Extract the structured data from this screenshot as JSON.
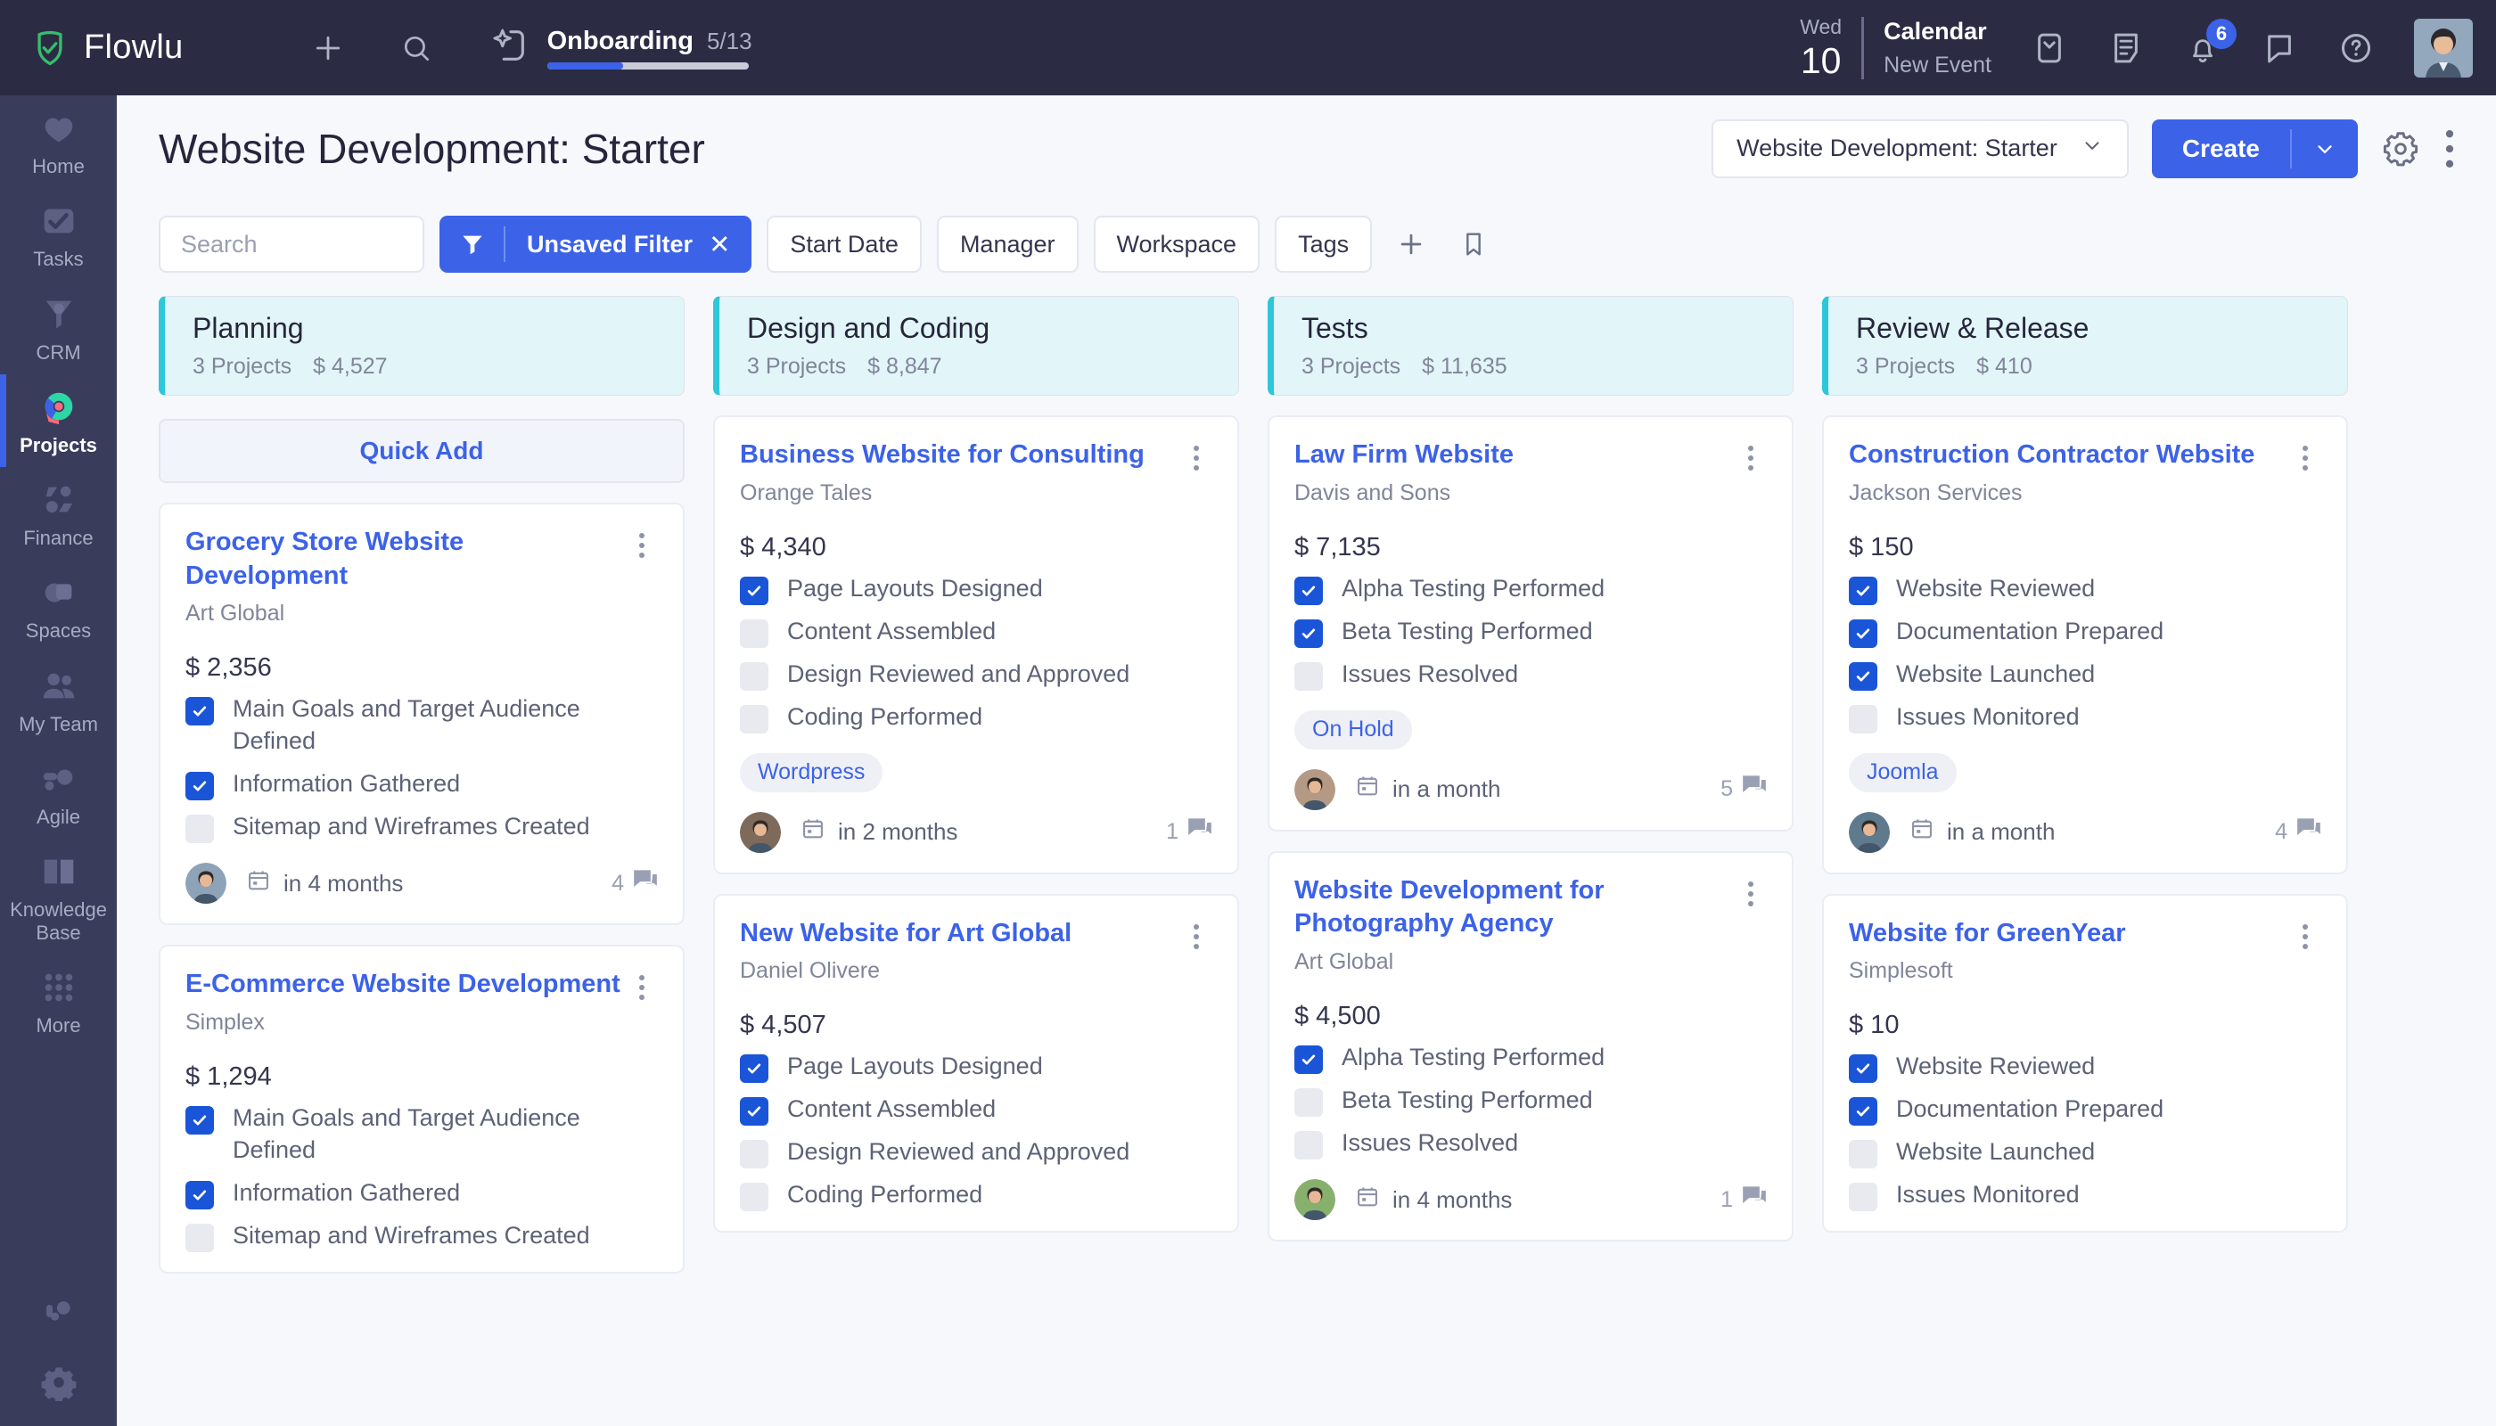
{
  "app": {
    "brand": "Flowlu",
    "accent": "#3c62e8",
    "topbar_bg": "#2b2c44",
    "sidebar_bg": "#3a3c5c",
    "column_accent": "#2ec6d9"
  },
  "topbar": {
    "add_icon": "plus-icon",
    "search_icon": "search-icon",
    "onboarding": {
      "label": "Onboarding",
      "count": "5/13",
      "progress_percent": 38
    },
    "calendar": {
      "weekday": "Wed",
      "day": "10",
      "title": "Calendar",
      "subtitle": "New Event"
    },
    "icons": [
      {
        "name": "mail-icon"
      },
      {
        "name": "notes-icon"
      },
      {
        "name": "bell-icon",
        "badge": "6"
      },
      {
        "name": "chat-icon"
      },
      {
        "name": "help-icon"
      }
    ],
    "avatar": "user-avatar"
  },
  "sidebar": {
    "items": [
      {
        "label": "Home",
        "icon": "home-icon",
        "active": false
      },
      {
        "label": "Tasks",
        "icon": "tasks-icon",
        "active": false
      },
      {
        "label": "CRM",
        "icon": "crm-icon",
        "active": false
      },
      {
        "label": "Projects",
        "icon": "projects-icon",
        "active": true
      },
      {
        "label": "Finance",
        "icon": "finance-icon",
        "active": false
      },
      {
        "label": "Spaces",
        "icon": "spaces-icon",
        "active": false
      },
      {
        "label": "My Team",
        "icon": "team-icon",
        "active": false
      },
      {
        "label": "Agile",
        "icon": "agile-icon",
        "active": false
      },
      {
        "label": "Knowledge Base",
        "icon": "knowledge-base-icon",
        "active": false
      },
      {
        "label": "More",
        "icon": "more-grid-icon",
        "active": false
      }
    ],
    "bottom": [
      {
        "name": "support-icon"
      },
      {
        "name": "settings-gear-icon"
      }
    ]
  },
  "header": {
    "title": "Website Development: Starter",
    "project_select": "Website Development: Starter",
    "create_label": "Create",
    "gear_icon": "gear-icon",
    "more_icon": "more-vertical-icon"
  },
  "filters": {
    "search_placeholder": "Search",
    "search_value": "",
    "active_filter": "Unsaved Filter",
    "buttons": [
      "Start Date",
      "Manager",
      "Workspace",
      "Tags"
    ],
    "add_icon": "plus-icon",
    "bookmark_icon": "bookmark-icon"
  },
  "board": {
    "columns": [
      {
        "name": "Planning",
        "projects_count": "3 Projects",
        "amount": "$ 4,527",
        "quick_add": "Quick Add",
        "has_quick_add": true,
        "cards": [
          {
            "title": "Grocery Store Website Development",
            "client": "Art Global",
            "amount": "$ 2,356",
            "tasks": [
              {
                "label": "Main Goals and Target Audience Defined",
                "done": true
              },
              {
                "label": "Information Gathered",
                "done": true
              },
              {
                "label": "Sitemap and Wireframes Created",
                "done": false
              }
            ],
            "tag": "",
            "due": "in 4 months",
            "comments": "4",
            "avatar": "#8fa3b8"
          },
          {
            "title": "E-Commerce Website Development",
            "client": "Simplex",
            "amount": "$ 1,294",
            "tasks": [
              {
                "label": "Main Goals and Target Audience Defined",
                "done": true
              },
              {
                "label": "Information Gathered",
                "done": true
              },
              {
                "label": "Sitemap and Wireframes Created",
                "done": false
              }
            ],
            "tag": "",
            "due": "",
            "comments": "",
            "avatar": "#8fa3b8"
          }
        ]
      },
      {
        "name": "Design and Coding",
        "projects_count": "3 Projects",
        "amount": "$ 8,847",
        "quick_add": "",
        "has_quick_add": false,
        "cards": [
          {
            "title": "Business Website for Consulting",
            "client": "Orange Tales",
            "amount": "$ 4,340",
            "tasks": [
              {
                "label": "Page Layouts Designed",
                "done": true
              },
              {
                "label": "Content Assembled",
                "done": false
              },
              {
                "label": "Design Reviewed and Approved",
                "done": false
              },
              {
                "label": "Coding Performed",
                "done": false
              }
            ],
            "tag": "Wordpress",
            "due": "in 2 months",
            "comments": "1",
            "avatar": "#7d6a5a"
          },
          {
            "title": "New Website for Art Global",
            "client": "Daniel Olivere",
            "amount": "$ 4,507",
            "tasks": [
              {
                "label": "Page Layouts Designed",
                "done": true
              },
              {
                "label": "Content Assembled",
                "done": true
              },
              {
                "label": "Design Reviewed and Approved",
                "done": false
              },
              {
                "label": "Coding Performed",
                "done": false
              }
            ],
            "tag": "",
            "due": "",
            "comments": "",
            "avatar": "#7d6a5a"
          }
        ]
      },
      {
        "name": "Tests",
        "projects_count": "3 Projects",
        "amount": "$ 11,635",
        "quick_add": "",
        "has_quick_add": false,
        "cards": [
          {
            "title": "Law Firm Website",
            "client": "Davis and Sons",
            "amount": "$ 7,135",
            "tasks": [
              {
                "label": "Alpha Testing Performed",
                "done": true
              },
              {
                "label": "Beta Testing Performed",
                "done": true
              },
              {
                "label": "Issues Resolved",
                "done": false
              }
            ],
            "tag": "On Hold",
            "due": "in a month",
            "comments": "5",
            "avatar": "#b49a85"
          },
          {
            "title": "Website Development for Photography Agency",
            "client": "Art Global",
            "amount": "$ 4,500",
            "tasks": [
              {
                "label": "Alpha Testing Performed",
                "done": true
              },
              {
                "label": "Beta Testing Performed",
                "done": false
              },
              {
                "label": "Issues Resolved",
                "done": false
              }
            ],
            "tag": "",
            "due": "in 4 months",
            "comments": "1",
            "avatar": "#86b06c"
          }
        ]
      },
      {
        "name": "Review & Release",
        "projects_count": "3 Projects",
        "amount": "$ 410",
        "quick_add": "",
        "has_quick_add": false,
        "cards": [
          {
            "title": "Construction Contractor Website",
            "client": "Jackson Services",
            "amount": "$ 150",
            "tasks": [
              {
                "label": "Website Reviewed",
                "done": true
              },
              {
                "label": "Documentation Prepared",
                "done": true
              },
              {
                "label": "Website Launched",
                "done": true
              },
              {
                "label": "Issues Monitored",
                "done": false
              }
            ],
            "tag": "Joomla",
            "due": "in a month",
            "comments": "4",
            "avatar": "#5f7a8c"
          },
          {
            "title": "Website for GreenYear",
            "client": "Simplesoft",
            "amount": "$ 10",
            "tasks": [
              {
                "label": "Website Reviewed",
                "done": true
              },
              {
                "label": "Documentation Prepared",
                "done": true
              },
              {
                "label": "Website Launched",
                "done": false
              },
              {
                "label": "Issues Monitored",
                "done": false
              }
            ],
            "tag": "",
            "due": "",
            "comments": "",
            "avatar": "#5f7a8c"
          }
        ]
      }
    ]
  }
}
